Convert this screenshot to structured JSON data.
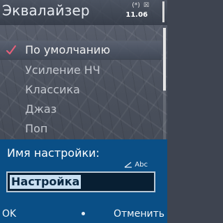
{
  "title": "Эквалайзер",
  "status": {
    "time": "11.06",
    "indicators": [
      "(*)",
      "☒"
    ]
  },
  "presets": {
    "selected_index": 0,
    "items": [
      {
        "label": "По умолчанию",
        "checked": true
      },
      {
        "label": "Усиление НЧ",
        "checked": false
      },
      {
        "label": "Классика",
        "checked": false
      },
      {
        "label": "Джаз",
        "checked": false
      },
      {
        "label": "Поп",
        "checked": false
      }
    ]
  },
  "query": {
    "label": "Имя настройки:",
    "input_mode": "Abc",
    "value": "Настройка"
  },
  "softkeys": {
    "left": "OK",
    "right": "Отменить"
  },
  "colors": {
    "panel_blue": "#0a4f86",
    "checkmark": "#e8607a"
  }
}
